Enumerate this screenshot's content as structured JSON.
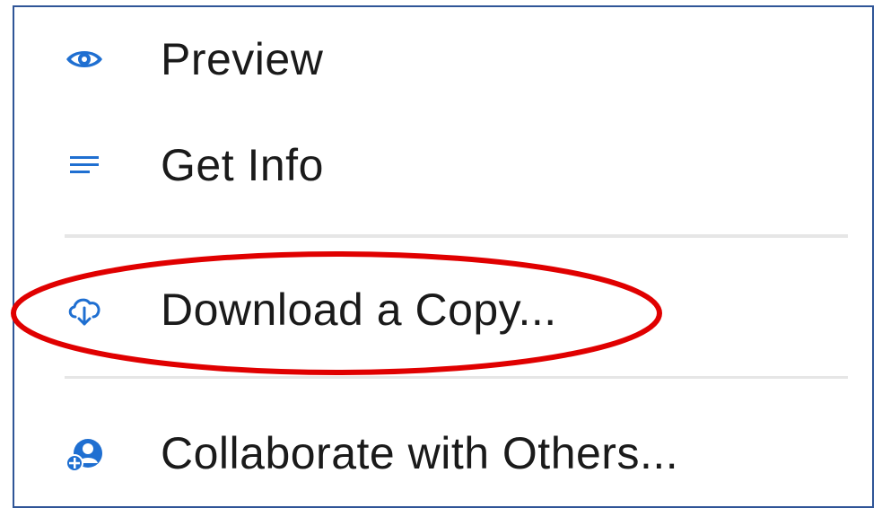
{
  "menu": {
    "items": [
      {
        "label": "Preview",
        "icon": "eye-icon"
      },
      {
        "label": "Get Info",
        "icon": "lines-icon"
      },
      {
        "label": "Download a Copy...",
        "icon": "cloud-download-icon"
      },
      {
        "label": "Collaborate with Others...",
        "icon": "collaborate-icon"
      }
    ]
  },
  "colors": {
    "icon": "#1f6fd1",
    "text": "#1a1a1a",
    "separator": "#e6e6e6",
    "frame_border": "#2f5597",
    "highlight_ellipse": "#e00000"
  }
}
